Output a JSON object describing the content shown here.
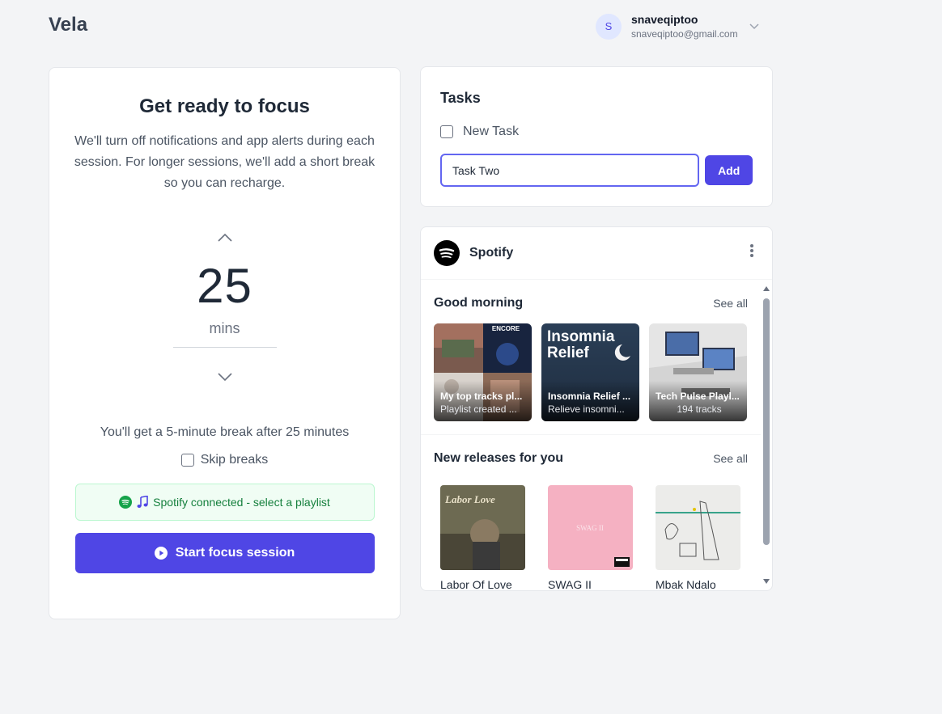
{
  "app": {
    "title": "Vela"
  },
  "account": {
    "initial": "S",
    "name": "snaveqiptoo",
    "email": "snaveqiptoo@gmail.com"
  },
  "focus": {
    "title": "Get ready to focus",
    "description": "We'll turn off notifications and app alerts during each session. For longer sessions, we'll add a short break so you can recharge.",
    "minutes": "25",
    "unit": "mins",
    "break_text": "You'll get a 5-minute break after 25 minutes",
    "skip_breaks_label": "Skip breaks",
    "skip_breaks_checked": false,
    "spotify_status": "Spotify connected - select a playlist",
    "start_label": "Start focus session"
  },
  "tasks": {
    "title": "Tasks",
    "items": [
      {
        "label": "New Task",
        "done": false
      }
    ],
    "input_value": "Task Two",
    "add_label": "Add"
  },
  "spotify": {
    "title": "Spotify",
    "good_morning": {
      "title": "Good morning",
      "see_all": "See all",
      "playlists": [
        {
          "name": "My top tracks pl...",
          "sub": "Playlist created ..."
        },
        {
          "name": "Insomnia Relief ...",
          "sub": "Relieve insomni...",
          "cover_text_1": "Insomnia",
          "cover_text_2": "Relief"
        },
        {
          "name": "Tech Pulse Playl...",
          "sub": "194 tracks"
        }
      ],
      "cover_badge": "ENCORE"
    },
    "new_releases": {
      "title": "New releases for you",
      "see_all": "See all",
      "albums": [
        {
          "name": "Labor Of Love",
          "cover_text": "Labor Love"
        },
        {
          "name": "SWAG II",
          "cover_text": "SWAG II"
        },
        {
          "name": "Mbak Ndalo"
        }
      ]
    }
  },
  "colors": {
    "accent": "#4f46e5",
    "spotify_green": "#16a34a",
    "background": "#f3f4f6"
  }
}
